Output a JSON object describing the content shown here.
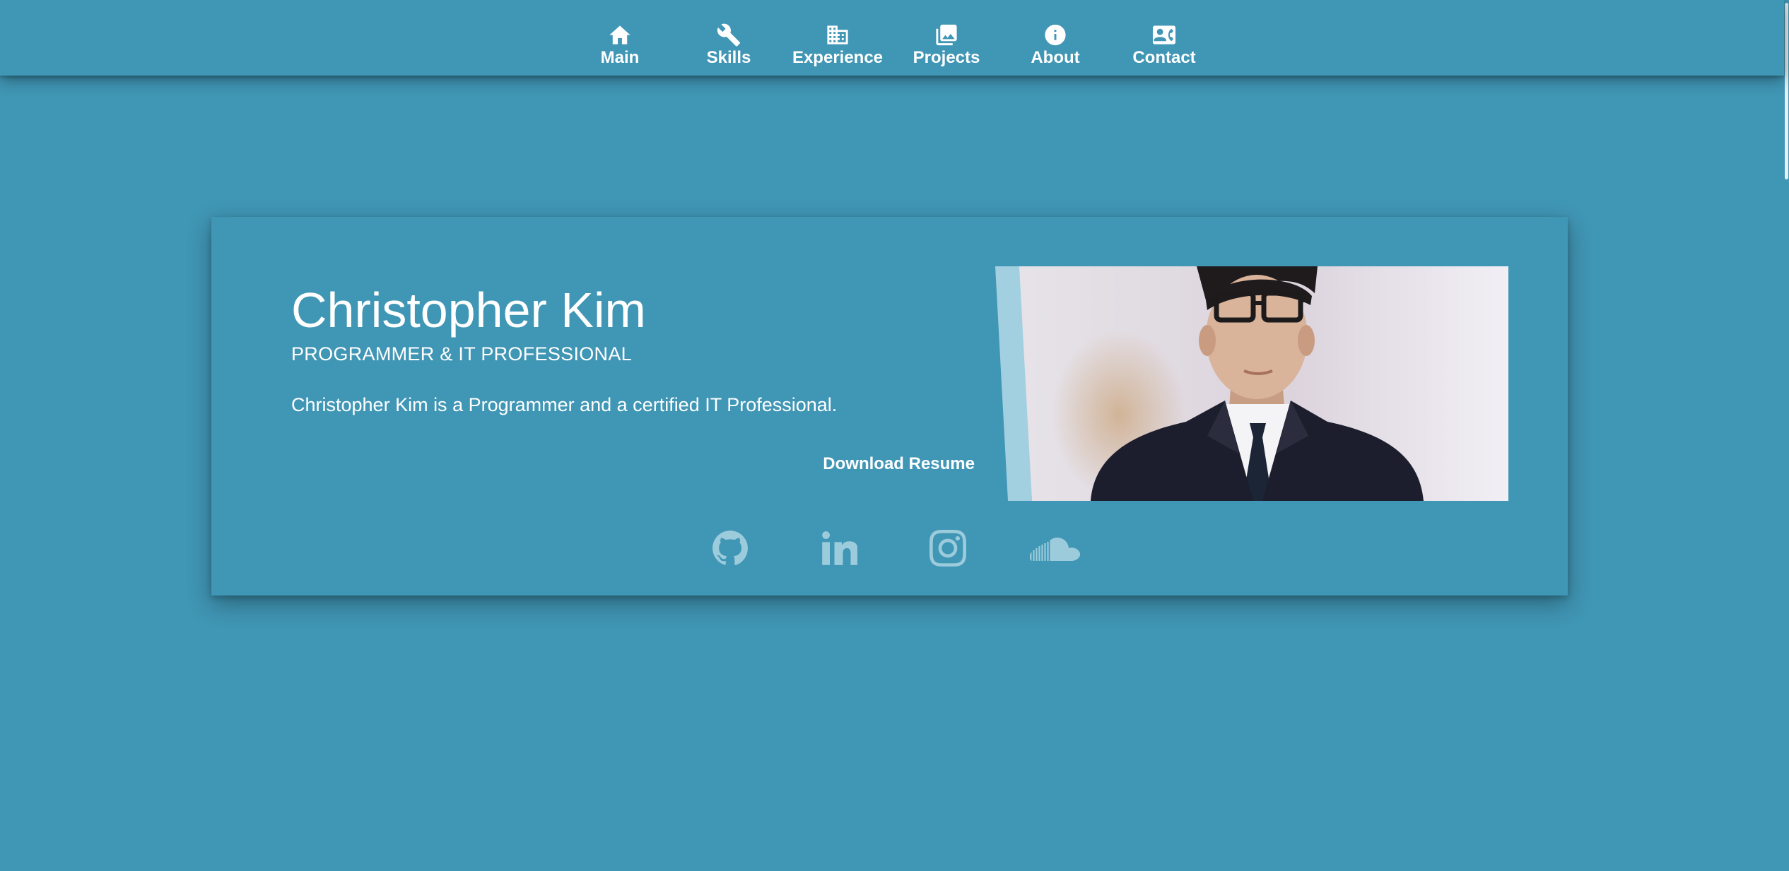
{
  "nav": {
    "items": [
      {
        "label": "Main",
        "icon": "home-icon"
      },
      {
        "label": "Skills",
        "icon": "wrench-icon"
      },
      {
        "label": "Experience",
        "icon": "building-icon"
      },
      {
        "label": "Projects",
        "icon": "images-icon"
      },
      {
        "label": "About",
        "icon": "info-icon"
      },
      {
        "label": "Contact",
        "icon": "contact-card-icon"
      }
    ]
  },
  "hero": {
    "name": "Christopher Kim",
    "title": "PROGRAMMER & IT PROFESSIONAL",
    "description": "Christopher Kim is a Programmer and a certified IT Professional.",
    "resume_label": "Download Resume",
    "photo_alt": "Christopher Kim"
  },
  "social": [
    {
      "icon": "github-icon"
    },
    {
      "icon": "linkedin-icon"
    },
    {
      "icon": "instagram-icon"
    },
    {
      "icon": "soundcloud-icon"
    }
  ],
  "colors": {
    "background": "#4096b5",
    "text": "#ffffff",
    "social_icon": "#9ccbdc",
    "photo_accent": "#a3d0e0"
  }
}
